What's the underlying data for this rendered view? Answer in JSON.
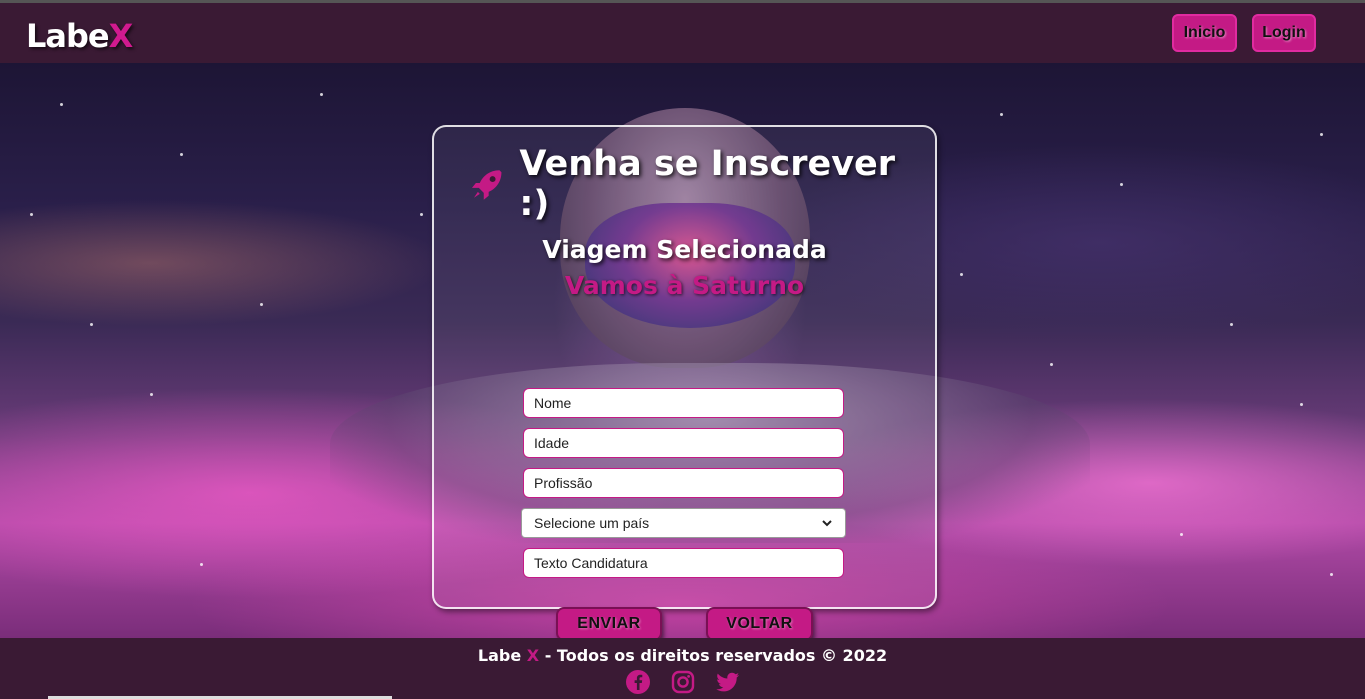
{
  "header": {
    "logo_main": "Labe",
    "logo_accent": "X",
    "nav": [
      {
        "label": "Inicio"
      },
      {
        "label": "Login"
      }
    ]
  },
  "form": {
    "title": "Venha se Inscrever :)",
    "subtitle": "Viagem Selecionada",
    "trip_name": "Vamos à Saturno",
    "name_placeholder": "Nome",
    "age_placeholder": "Idade",
    "profession_placeholder": "Profissão",
    "country_select": "Selecione um país",
    "text_placeholder": "Texto Candidatura",
    "submit_label": "ENVIAR",
    "back_label": "VOLTAR"
  },
  "footer": {
    "brand_main": "Labe",
    "brand_accent": "X",
    "copyright": " - Todos os direitos reservados © 2022",
    "social": [
      "facebook-icon",
      "instagram-icon",
      "twitter-icon"
    ]
  },
  "colors": {
    "accent": "#c41a85",
    "background": "#3a1a34"
  }
}
